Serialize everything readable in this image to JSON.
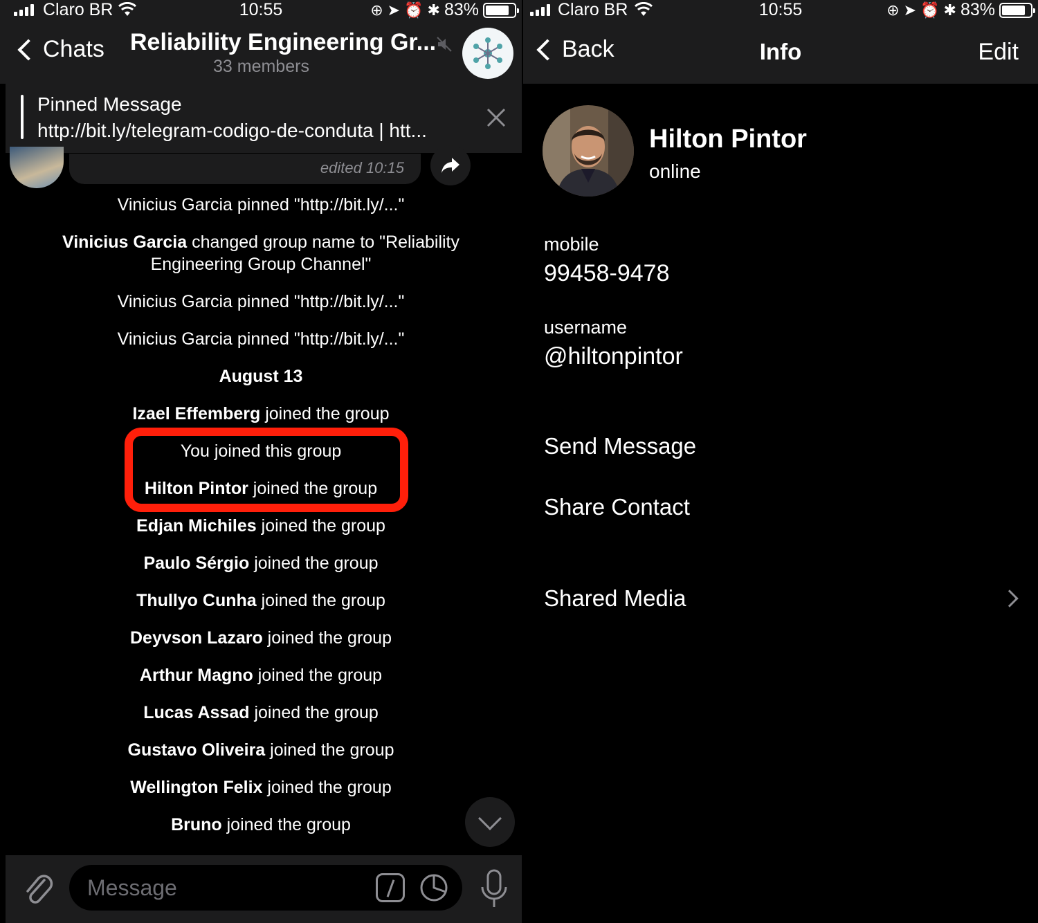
{
  "status_bar": {
    "carrier": "Claro BR",
    "time": "10:55",
    "battery": "83%",
    "battery_level": 0.83
  },
  "chat": {
    "back_label": "Chats",
    "title": "Reliability Engineering Gr...",
    "subtitle": "33 members",
    "pinned": {
      "title": "Pinned Message",
      "text": "http://bit.ly/telegram-codigo-de-conduta | htt..."
    },
    "edited_label": "edited 10:15",
    "service_messages": [
      {
        "name": "",
        "text": "Vinicius Garcia pinned \"http://bit.ly/...\""
      },
      {
        "name": "Vinicius Garcia",
        "text": " changed group name to \"Reliability"
      },
      {
        "name": "",
        "text": "Engineering Group Channel\""
      },
      {
        "name": "",
        "text": "Vinicius Garcia pinned \"http://bit.ly/...\""
      },
      {
        "name": "",
        "text": "Vinicius Garcia pinned \"http://bit.ly/...\""
      }
    ],
    "date_separator": "August 13",
    "joins": [
      {
        "name": "Izael Effemberg",
        "text": " joined the group"
      },
      {
        "name": "",
        "text": "You joined this group"
      },
      {
        "name": "Hilton Pintor",
        "text": " joined the group"
      },
      {
        "name": "Edjan Michiles",
        "text": " joined the group"
      },
      {
        "name": "Paulo Sérgio",
        "text": " joined the group"
      },
      {
        "name": "Thullyo Cunha",
        "text": " joined the group"
      },
      {
        "name": "Deyvson Lazaro",
        "text": " joined the group"
      },
      {
        "name": "Arthur Magno",
        "text": " joined the group"
      },
      {
        "name": "Lucas Assad",
        "text": " joined the group"
      },
      {
        "name": "Gustavo Oliveira",
        "text": " joined the group"
      },
      {
        "name": "Wellington Felix",
        "text": " joined the group"
      },
      {
        "name": "Bruno",
        "text": " joined the group"
      }
    ],
    "input_placeholder": "Message"
  },
  "info": {
    "back_label": "Back",
    "title": "Info",
    "edit_label": "Edit",
    "name": "Hilton Pintor",
    "status": "online",
    "mobile_label": "mobile",
    "mobile_value": "99458-9478",
    "username_label": "username",
    "username_value": "@hiltonpintor",
    "actions": {
      "send_message": "Send Message",
      "share_contact": "Share Contact",
      "shared_media": "Shared Media"
    }
  },
  "colors": {
    "background": "#000000",
    "bar": "#1c1c1d",
    "highlight": "#ff1f0a",
    "secondary_text": "#8e8e93"
  }
}
